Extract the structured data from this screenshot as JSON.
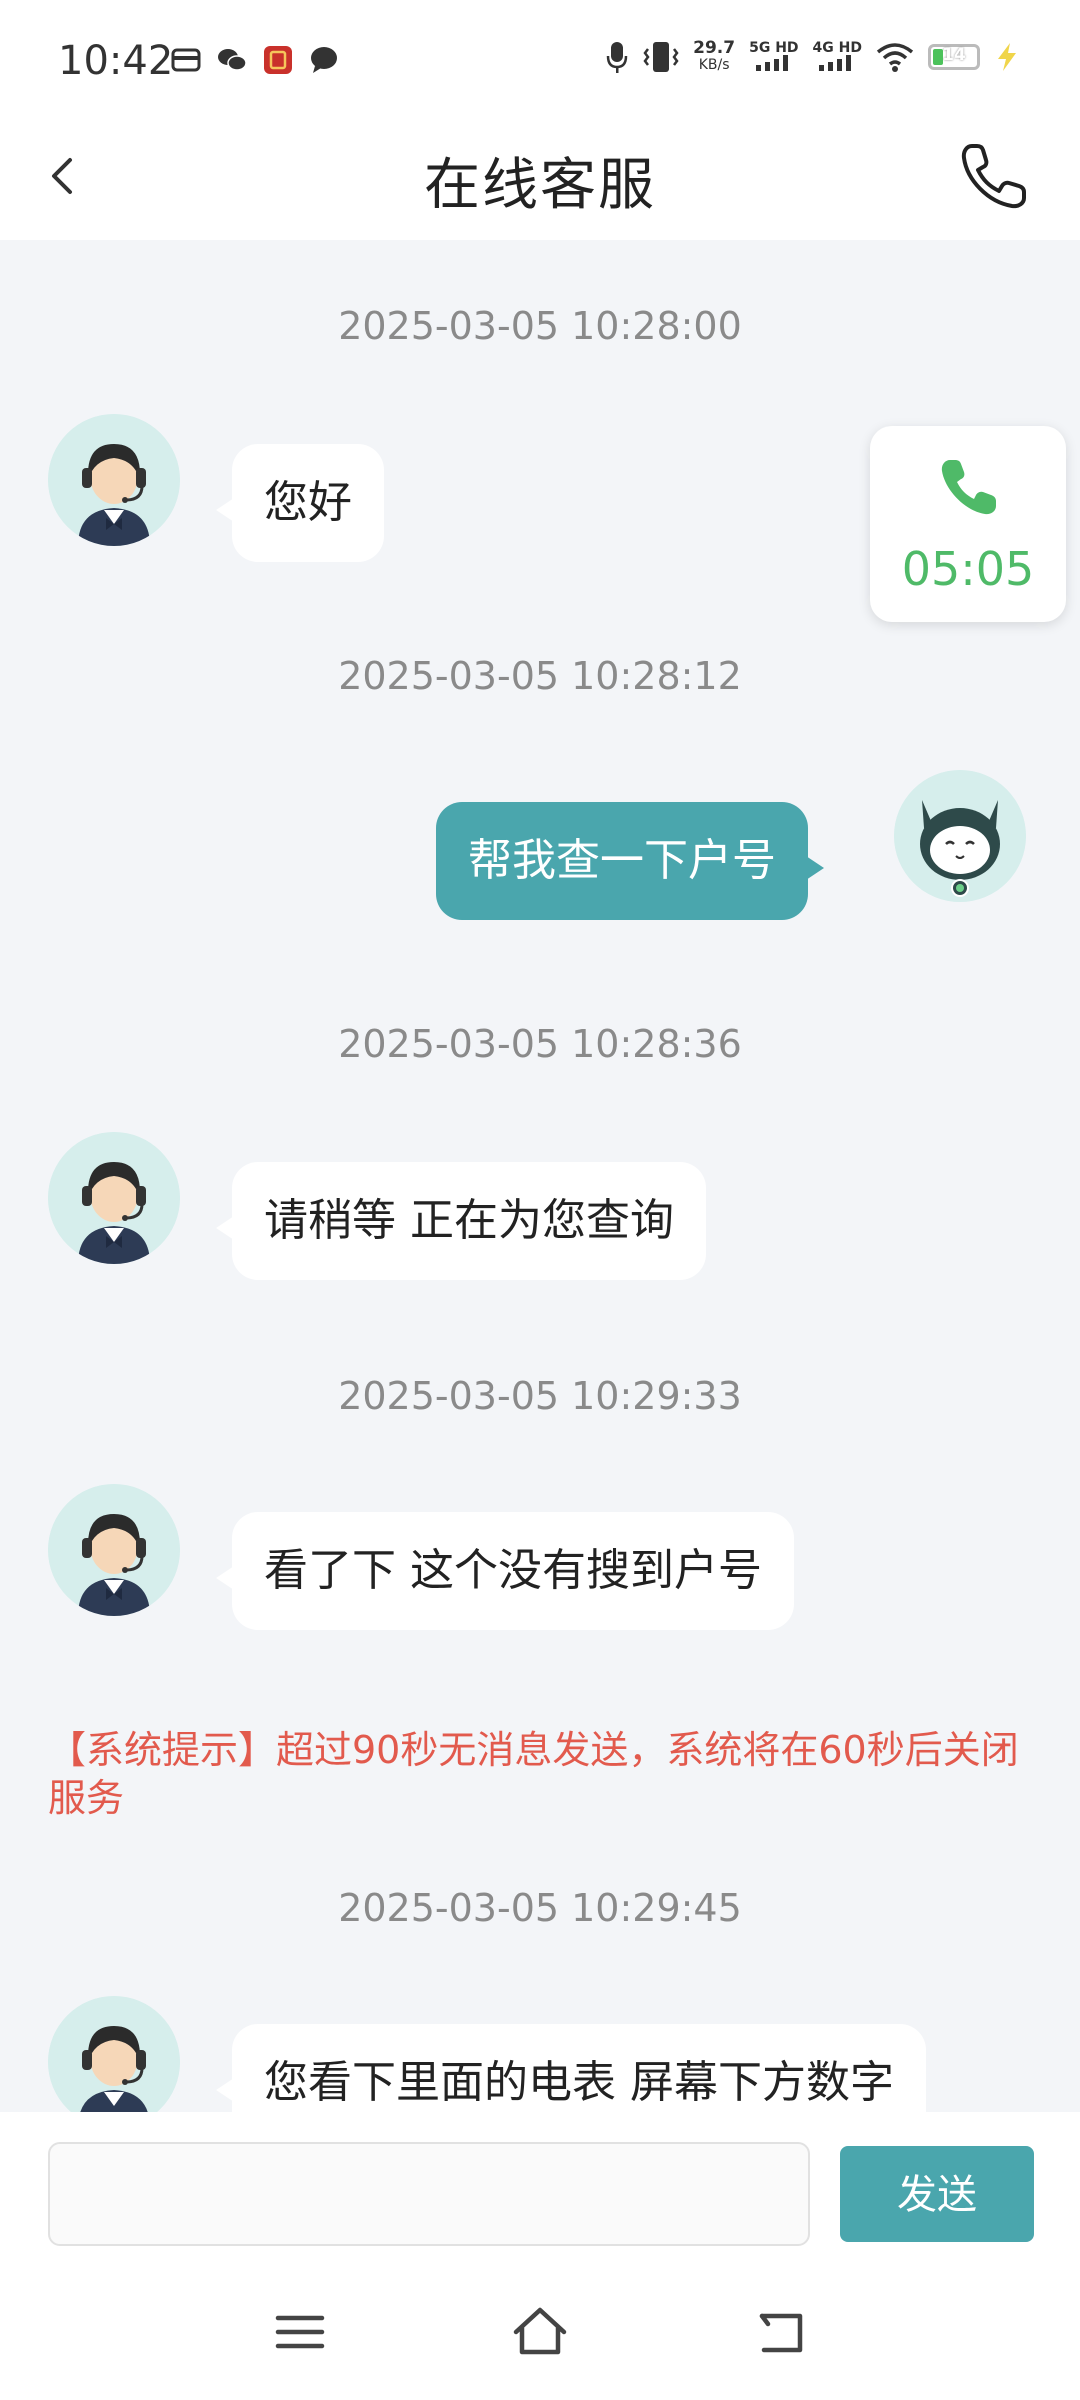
{
  "status_bar": {
    "time": "10:42",
    "net_speed_value": "29.7",
    "net_speed_unit": "KB/s",
    "sim1": "5G HD",
    "sim2": "4G HD",
    "battery": "14"
  },
  "header": {
    "title": "在线客服"
  },
  "messages": [
    {
      "timestamp": "2025-03-05 10:28:00",
      "sender": "agent",
      "text": "您好"
    },
    {
      "timestamp": "2025-03-05 10:28:12",
      "sender": "user",
      "text": "帮我查一下户号"
    },
    {
      "timestamp": "2025-03-05 10:28:36",
      "sender": "agent",
      "text": "请稍等 正在为您查询"
    },
    {
      "timestamp": "2025-03-05 10:29:33",
      "sender": "agent",
      "text": "看了下 这个没有搜到户号"
    },
    {
      "timestamp": "2025-03-05 10:29:45",
      "sender": "agent",
      "text": "您看下里面的电表 屏幕下方数字"
    }
  ],
  "system_tip": "【系统提示】超过90秒无消息发送，系统将在60秒后关闭服务",
  "call_widget": {
    "duration": "05:05"
  },
  "input_bar": {
    "placeholder": "",
    "send_label": "发送"
  },
  "colors": {
    "accent": "#4aa6ad",
    "call_green": "#4fba68",
    "system_tip": "#e25a4d",
    "background": "#f3f5f8"
  },
  "icons": {
    "back": "chevron-left-icon",
    "phone": "phone-icon",
    "nav_menu": "menu-icon",
    "nav_home": "home-icon",
    "nav_back": "back-icon"
  }
}
